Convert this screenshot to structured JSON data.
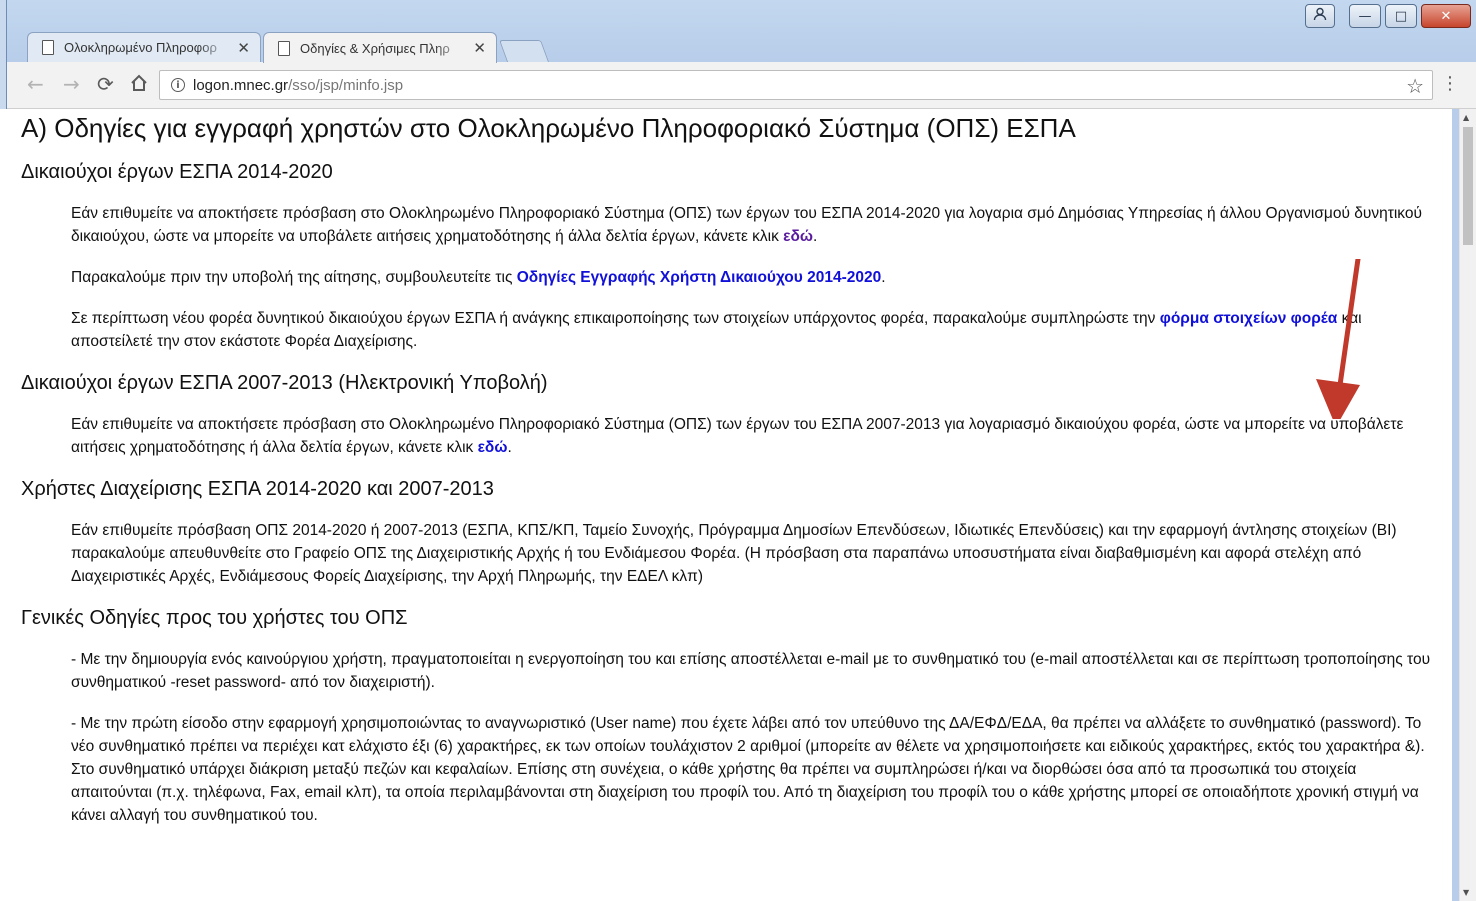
{
  "browser": {
    "tabs": [
      {
        "title": "Ολοκληρωμένο Πληροφορ",
        "active": false
      },
      {
        "title": "Οδηγίες & Χρήσιμες Πληρ",
        "active": true
      }
    ],
    "tab_close": "✕",
    "url_host": "logon.mnec.gr",
    "url_path": "/sso/jsp/minfo.jsp",
    "window_controls": {
      "minimize": "—",
      "maximize": "□",
      "close": "✕",
      "user": "👤"
    }
  },
  "page": {
    "title": "Α) Οδηγίες για εγγραφή χρηστών στο Ολοκληρωμένο Πληροφοριακό Σύστημα (ΟΠΣ) ΕΣΠΑ",
    "sec1": {
      "heading": "Δικαιούχοι έργων ΕΣΠΑ 2014-2020",
      "p1_text": "Εάν επιθυμείτε να αποκτήσετε πρόσβαση στο Ολοκληρωμένο Πληροφοριακό Σύστημα (ΟΠΣ) των έργων του ΕΣΠΑ 2014-2020 για λογαρια σμό Δημόσιας Υπηρεσίας ή άλλου Οργανισμού δυνητικού δικαιούχου, ώστε να μπορείτε να υποβάλετε αιτήσεις χρηματοδότησης ή άλλα δελτία έργων, κάνετε κλικ ",
      "p1_link": "εδώ",
      "p1_end": ".",
      "p2_text": "Παρακαλούμε πριν την υποβολή της αίτησης, συμβουλευτείτε τις ",
      "p2_link": "Οδηγίες Εγγραφής Χρήστη Δικαιούχου 2014-2020",
      "p2_end": ".",
      "p3_text": "Σε περίπτωση νέου φορέα δυνητικού δικαιούχου έργων ΕΣΠΑ ή ανάγκης επικαιροποίησης των στοιχείων υπάρχοντος φορέα, παρακαλούμε συμπληρώστε την ",
      "p3_link": "φόρμα στοιχείων φορέα",
      "p3_end": " και αποστείλετέ την στον εκάστοτε Φορέα Διαχείρισης."
    },
    "sec2": {
      "heading": "Δικαιούχοι έργων ΕΣΠΑ 2007-2013 (Ηλεκτρονική Υποβολή)",
      "p1_text": "Εάν επιθυμείτε να αποκτήσετε πρόσβαση στο Ολοκληρωμένο Πληροφοριακό Σύστημα (ΟΠΣ) των έργων του ΕΣΠΑ 2007-2013 για λογαριασμό δικαιούχου φορέα, ώστε να μπορείτε να υποβάλετε αιτήσεις χρηματοδότησης ή άλλα δελτία έργων, κάνετε κλικ ",
      "p1_link": "εδώ",
      "p1_end": "."
    },
    "sec3": {
      "heading": "Χρήστες Διαχείρισης ΕΣΠΑ 2014-2020 και 2007-2013",
      "p1_text": "Εάν επιθυμείτε πρόσβαση ΟΠΣ 2014-2020 ή 2007-2013 (ΕΣΠΑ, ΚΠΣ/ΚΠ, Ταμείο Συνοχής, Πρόγραμμα Δημοσίων Επενδύσεων, Ιδιωτικές Επενδύσεις) και την εφαρμογή άντλησης στοιχείων (BI) παρακαλούμε απευθυνθείτε στο Γραφείο ΟΠΣ της Διαχειριστικής Αρχής ή του Ενδιάμεσου Φορέα. (Η πρόσβαση στα παραπάνω υποσυστήματα είναι διαβαθμισμένη και αφορά στελέχη από Διαχειριστικές Αρχές, Ενδιάμεσους Φορείς Διαχείρισης, την Αρχή Πληρωμής, την ΕΔΕΛ κλπ)"
    },
    "sec4": {
      "heading": "Γενικές Οδηγίες προς του χρήστες του ΟΠΣ",
      "p1_text": "- Με την δημιουργία ενός καινούργιου χρήστη, πραγματοποιείται η ενεργοποίηση του και επίσης αποστέλλεται e-mail με το συνθηματικό του (e-mail αποστέλλεται και σε περίπτωση τροποποίησης του συνθηματικού -reset password- από τον διαχειριστή).",
      "p2_text": "- Με την πρώτη είσοδο στην εφαρμογή χρησιμοποιώντας το αναγνωριστικό (User name) που έχετε λάβει από τον υπεύθυνο της ΔΑ/ΕΦΔ/ΕΔΑ, θα πρέπει να αλλάξετε το συνθηματικό (password). Το νέο συνθηματικό πρέπει να περιέχει κατ ελάχιστο έξι (6) χαρακτήρες, εκ των οποίων τουλάχιστον 2 αριθμοί (μπορείτε αν θέλετε να χρησιμοποιήσετε και ειδικούς χαρακτήρες, εκτός του χαρακτήρα &). Στο συνθηματικό υπάρχει διάκριση μεταξύ πεζών και κεφαλαίων. Επίσης στη συνέχεια, ο κάθε χρήστης θα πρέπει να συμπληρώσει ή/και να διορθώσει όσα από τα προσωπικά του στοιχεία απαιτούνται (π.χ. τηλέφωνα, Fax, email κλπ), τα οποία περιλαμβάνονται στη διαχείριση του προφίλ του. Από τη διαχείριση του προφίλ του ο κάθε χρήστης μπορεί σε οποιαδήποτε χρονική στιγμή να κάνει αλλαγή του συνθηματικού του."
    }
  },
  "colors": {
    "link": "#1010d8",
    "visited_link": "#5a1a9e",
    "annotation_arrow": "#c0392b"
  },
  "icons": [
    "page-icon",
    "close-icon",
    "back-icon",
    "forward-icon",
    "reload-icon",
    "home-icon",
    "info-icon",
    "star-icon",
    "menu-icon",
    "annotation-arrow-icon"
  ]
}
